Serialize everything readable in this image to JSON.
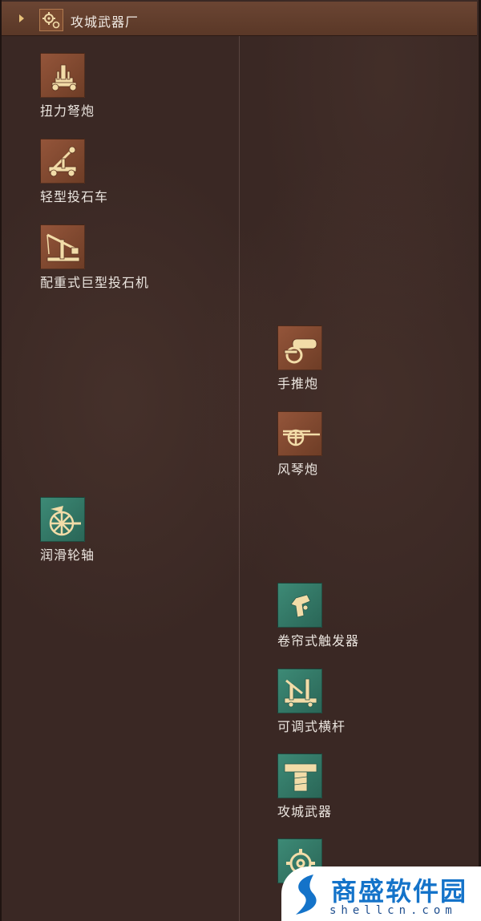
{
  "header": {
    "title": "攻城武器厂",
    "icon": "gears-icon"
  },
  "left_column": [
    {
      "label": "扭力弩炮",
      "icon": "ballista-icon",
      "tile_color": "brown"
    },
    {
      "label": "轻型投石车",
      "icon": "catapult-icon",
      "tile_color": "brown"
    },
    {
      "label": "配重式巨型投石机",
      "icon": "trebuchet-icon",
      "tile_color": "brown"
    },
    {
      "label": "润滑轮轴",
      "icon": "wheel-axle-icon",
      "tile_color": "teal"
    }
  ],
  "right_column": [
    {
      "label": "手推炮",
      "icon": "cannon-icon",
      "tile_color": "brown"
    },
    {
      "label": "风琴炮",
      "icon": "organ-gun-icon",
      "tile_color": "brown"
    },
    {
      "label": "卷帘式触发器",
      "icon": "trigger-icon",
      "tile_color": "teal"
    },
    {
      "label": "可调式横杆",
      "icon": "adjustable-crossbar-icon",
      "tile_color": "teal"
    },
    {
      "label": "攻城武器",
      "icon": "siege-beam-icon",
      "tile_color": "teal"
    },
    {
      "label": "",
      "icon": "gear-wheel-icon",
      "tile_color": "teal"
    }
  ],
  "watermark": {
    "title": "商盛软件园",
    "url": "shellcn.com"
  },
  "colors": {
    "background": "#3a2824",
    "header": "#6b4533",
    "tile_brown": "#94553a",
    "tile_teal": "#3d8a76",
    "watermark_blue": "#1473c9"
  }
}
